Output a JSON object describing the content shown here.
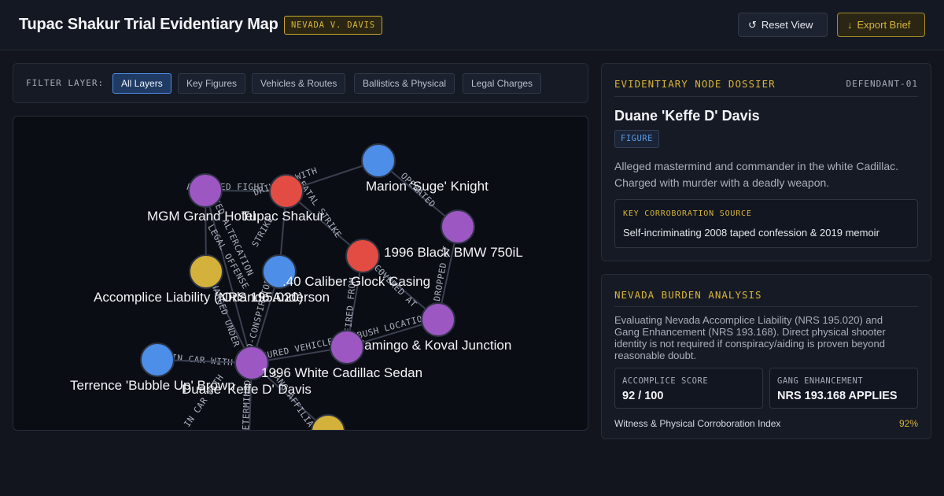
{
  "header": {
    "title": "Tupac Shakur Trial Evidentiary Map",
    "case_badge": "NEVADA V. DAVIS",
    "reset_button": "Reset View",
    "export_button": "Export Brief",
    "reset_icon": "reset-icon",
    "export_icon": "download-arrow-icon"
  },
  "filters": {
    "label": "FILTER LAYER:",
    "chips": [
      "All Layers",
      "Key Figures",
      "Vehicles & Routes",
      "Ballistics & Physical",
      "Legal Charges"
    ],
    "active": "All Layers"
  },
  "graph": {
    "colors": {
      "figure": "#4c8ee8",
      "vehicle": "#e24c42",
      "location": "#9d57c3",
      "legal": "#d4b13a"
    },
    "nodes": [
      {
        "id": "suge",
        "label": "Marion 'Suge' Knight",
        "kind": "figure"
      },
      {
        "id": "mgm",
        "label": "MGM Grand Hotel",
        "kind": "location"
      },
      {
        "id": "tupac",
        "label": "Tupac Shakur",
        "kind": "vehicle"
      },
      {
        "id": "loc1",
        "label": "",
        "kind": "location"
      },
      {
        "id": "bmw",
        "label": "1996 Black BMW 750iL",
        "kind": "vehicle"
      },
      {
        "id": "nrs",
        "label": "Accomplice Liability (NRS 195.020)",
        "kind": "legal"
      },
      {
        "id": "glock",
        "label": ".40 Caliber Glock Casing",
        "kind": "figure"
      },
      {
        "id": "anderson",
        "label": "Orlando Anderson",
        "kind": "figure"
      },
      {
        "id": "koval",
        "label": "Flamingo & Koval Junction",
        "kind": "location"
      },
      {
        "id": "loc2",
        "label": "",
        "kind": "location"
      },
      {
        "id": "bubble",
        "label": "Terrence 'Bubble Up' Brown",
        "kind": "figure"
      },
      {
        "id": "cadillac",
        "label": "1996 White Cadillac Sedan",
        "kind": "location"
      },
      {
        "id": "keffe",
        "label": "Duane 'Keffe D' Davis",
        "kind": "figure"
      },
      {
        "id": "legal2",
        "label": "",
        "kind": "legal"
      }
    ],
    "edges": [
      {
        "label": "ATTENDED FIGHT"
      },
      {
        "label": "DRIVING WITH"
      },
      {
        "label": "OPERATED"
      },
      {
        "label": "FATAL STRIKE"
      },
      {
        "label": "SPARKED ALTERCATION"
      },
      {
        "label": "STRIKE"
      },
      {
        "label": "RECOVERED AT"
      },
      {
        "label": "DROPPED AT"
      },
      {
        "label": "LEGAL OFFENSE"
      },
      {
        "label": "CHARGED UNDER"
      },
      {
        "label": "CO-CONSPIRATOR"
      },
      {
        "label": "FIRED FROM"
      },
      {
        "label": "AMBUSH LOCATION"
      },
      {
        "label": "IN CAR WITH"
      },
      {
        "label": "SECURED VEHICLE"
      },
      {
        "label": "IN CAR WITH"
      },
      {
        "label": "DETERMINED"
      },
      {
        "label": "GANG AFFILIATION"
      }
    ]
  },
  "dossier": {
    "heading": "EVIDENTIARY NODE DOSSIER",
    "tag": "DEFENDANT-01",
    "name": "Duane 'Keffe D' Davis",
    "type": "FIGURE",
    "description": "Alleged mastermind and commander in the white Cadillac. Charged with murder with a deadly weapon.",
    "source_label": "KEY CORROBORATION SOURCE",
    "source_value": "Self-incriminating 2008 taped confession & 2019 memoir"
  },
  "burden": {
    "heading": "NEVADA BURDEN ANALYSIS",
    "description": "Evaluating Nevada Accomplice Liability (NRS 195.020) and Gang Enhancement (NRS 193.168). Direct physical shooter identity is not required if conspiracy/aiding is proven beyond reasonable doubt.",
    "metrics": [
      {
        "label": "ACCOMPLICE SCORE",
        "value": "92 / 100"
      },
      {
        "label": "GANG ENHANCEMENT",
        "value": "NRS 193.168 APPLIES"
      }
    ],
    "index_label": "Witness & Physical Corroboration Index",
    "index_value": "92%"
  }
}
